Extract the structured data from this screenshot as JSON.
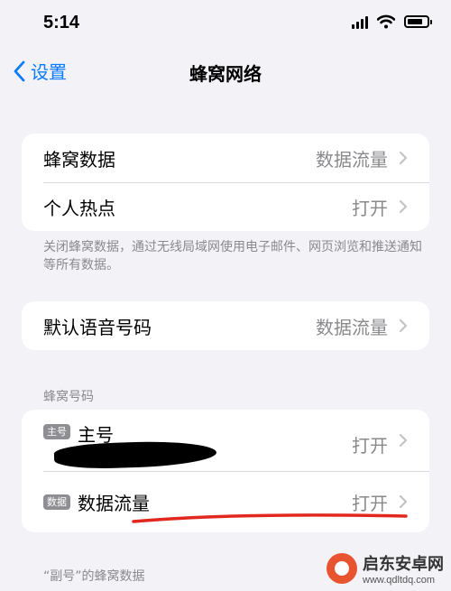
{
  "status_bar": {
    "time": "5:14",
    "battery_level": 0.8
  },
  "nav": {
    "back_label": "设置",
    "title": "蜂窝网络"
  },
  "group1": {
    "rows": [
      {
        "label": "蜂窝数据",
        "value": "数据流量"
      },
      {
        "label": "个人热点",
        "value": "打开"
      }
    ],
    "footer": "关闭蜂窝数据，通过无线局域网使用电子邮件、网页浏览和推送通知等所有数据。"
  },
  "group2": {
    "rows": [
      {
        "label": "默认语音号码",
        "value": "数据流量"
      }
    ]
  },
  "cellular_numbers": {
    "header": "蜂窝号码",
    "rows": [
      {
        "badge": "主号",
        "label": "主号",
        "value": "打开"
      },
      {
        "badge": "数据",
        "label": "数据流量",
        "value": "打开"
      }
    ]
  },
  "secondary_header": "“副号”的蜂窝数据",
  "watermark": {
    "name": "启东安卓网",
    "url": "www.qdltdq.com"
  },
  "colors": {
    "accent": "#0a7aff",
    "background": "#f2f2f7",
    "annotation_red": "#e2281e"
  }
}
